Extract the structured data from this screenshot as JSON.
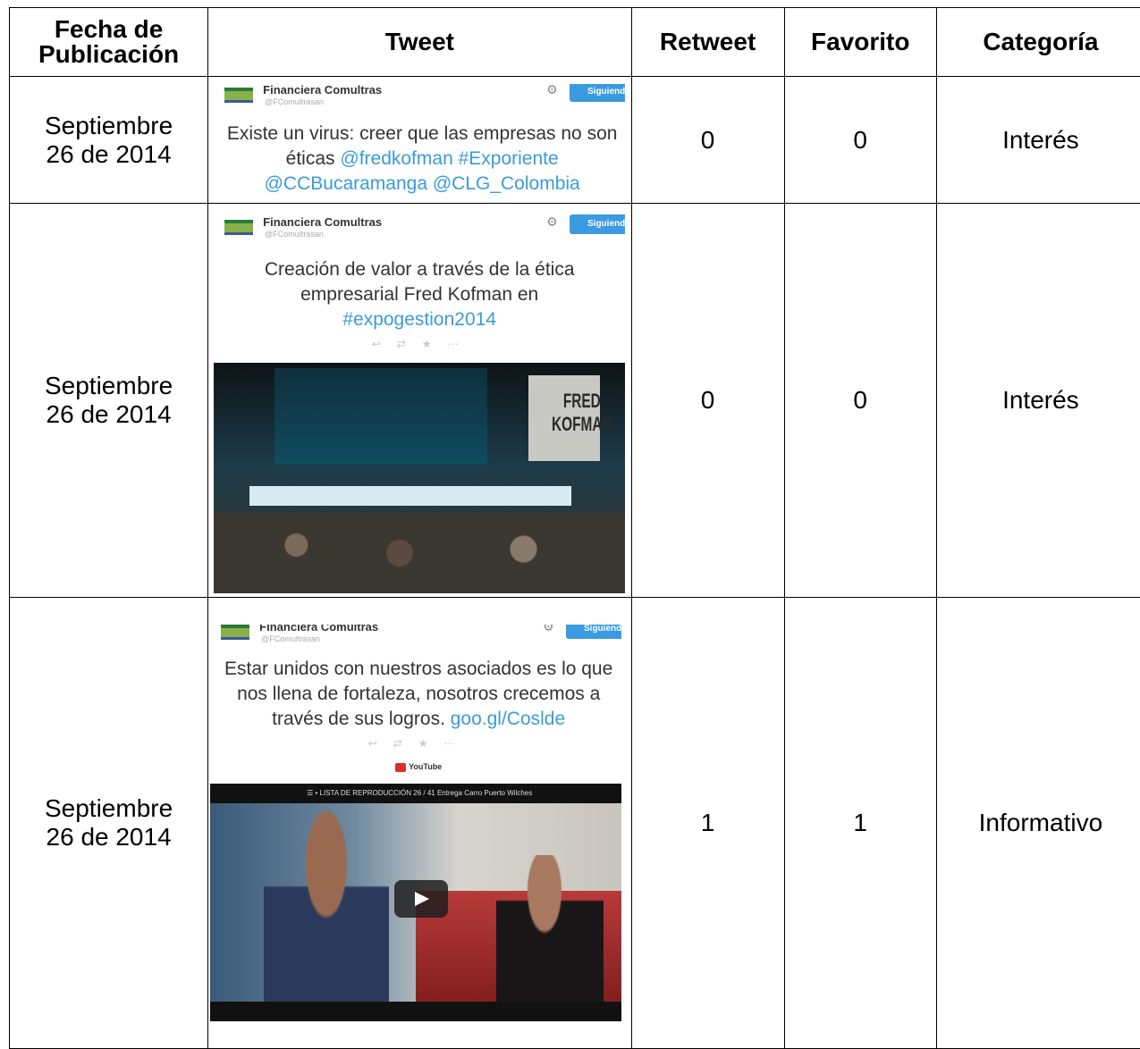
{
  "headers": {
    "date": "Fecha de Publicación",
    "tweet": "Tweet",
    "retweet": "Retweet",
    "favorite": "Favorito",
    "category": "Categoría"
  },
  "rows": [
    {
      "date": "Septiembre 26 de 2014",
      "account": "Financiera Comultras",
      "handle": "@FComultrasan",
      "follow": "Siguiendo",
      "text_plain": "Existe un virus: creer que las empresas no son éticas ",
      "text_links": "@fredkofman #Exporiente @CCBucaramanga @CLG_Colombia",
      "retweet": "0",
      "favorite": "0",
      "category": "Interés"
    },
    {
      "date": "Septiembre 26 de 2014",
      "account": "Financiera Comultras",
      "handle": "@FComultrasan",
      "follow": "Siguiendo",
      "text_plain": "Creación de valor a través de la ética empresarial Fred Kofman en ",
      "text_links": "#expogestion2014",
      "photo_caption": "FRED KOFMAN",
      "retweet": "0",
      "favorite": "0",
      "category": "Interés"
    },
    {
      "date": "Septiembre 26 de 2014",
      "account": "Financiera Comultras",
      "handle": "@FComultrasan",
      "follow": "Siguiendo",
      "text_plain": "Estar unidos con nuestros asociados es lo que nos llena de fortaleza, nosotros crecemos a través de sus logros. ",
      "text_links": "goo.gl/Coslde",
      "youtube": "YouTube",
      "video_bar": "☰ • LISTA DE REPRODUCCIÓN    26 / 41    Entrega Carro Puerto Wilches",
      "retweet": "1",
      "favorite": "1",
      "category": "Informativo"
    }
  ],
  "icons": {
    "gear": "gear-icon",
    "reply": "reply-icon",
    "retweet": "retweet-icon",
    "favorite": "star-icon",
    "more": "more-icon",
    "play": "play-icon",
    "youtube": "youtube-icon"
  },
  "colors": {
    "link": "#3b9bd7",
    "follow_button": "#3a9be0",
    "youtube_red": "#d9302a"
  }
}
